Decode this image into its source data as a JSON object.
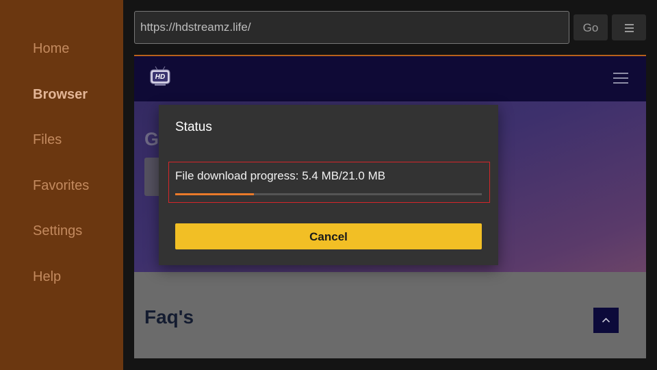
{
  "sidebar": {
    "items": [
      {
        "label": "Home",
        "active": false
      },
      {
        "label": "Browser",
        "active": true
      },
      {
        "label": "Files",
        "active": false
      },
      {
        "label": "Favorites",
        "active": false
      },
      {
        "label": "Settings",
        "active": false
      },
      {
        "label": "Help",
        "active": false
      }
    ]
  },
  "toolbar": {
    "url_value": "https://hdstreamz.life/",
    "go_label": "Go",
    "menu_icon": "hamburger-icon"
  },
  "webpage": {
    "logo_icon": "hdstreamz-logo",
    "hero_partial_text": "G",
    "faq_title": "Faq's",
    "scroll_top_icon": "chevron-up-icon"
  },
  "dialog": {
    "title": "Status",
    "progress_text": "File download progress: 5.4 MB/21.0 MB",
    "progress_fraction": 0.257,
    "cancel_label": "Cancel"
  },
  "colors": {
    "sidebar_bg": "#6b3710",
    "accent_orange": "#ea7a2a",
    "cancel_yellow": "#f2bf25",
    "highlight_red": "#d6262a",
    "site_header": "#0f0a36"
  }
}
